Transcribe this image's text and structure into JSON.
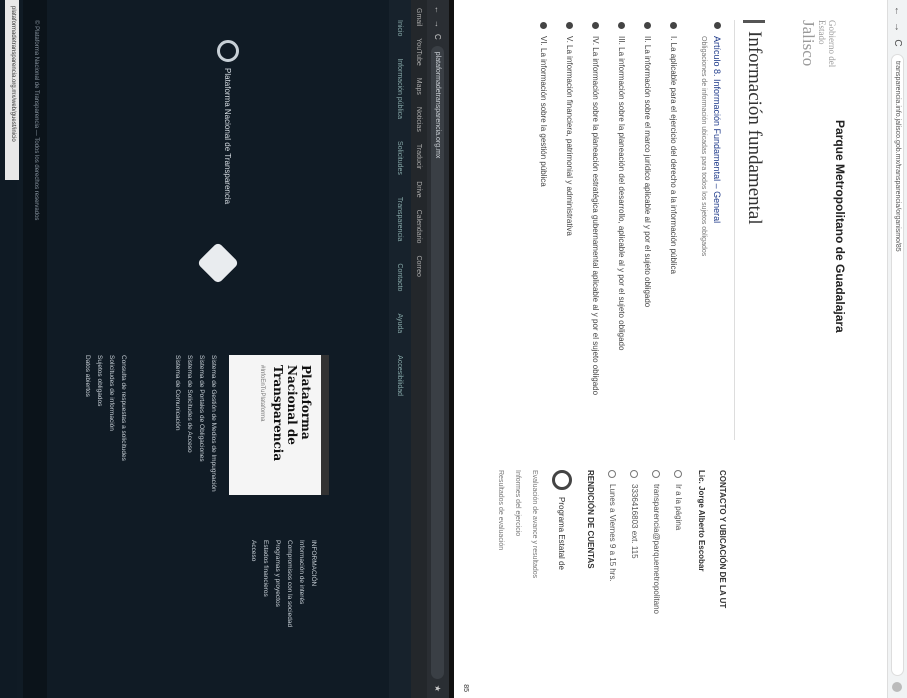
{
  "right_page": {
    "browser": {
      "url": "transparencia.info.jalisco.gob.mx/transparencia/organismo/85",
      "back": "←",
      "forward": "→",
      "reload": "C"
    },
    "logo": {
      "line1": "Gobierno del Estado",
      "line2": "Jalisco"
    },
    "org_title": "Parque Metropolitano de Guadalajara",
    "section_title": "Información fundamental",
    "obligations": [
      {
        "label": "Artículo 8. Información Fundamental – General",
        "sub": "Obligaciones de información ubicadas para todos los sujetos obligados"
      },
      {
        "label": "I. La aplicable para el ejercicio del derecho a la información pública"
      },
      {
        "label": "II. La información sobre el marco jurídico aplicable al y por el sujeto obligado"
      },
      {
        "label": "III. La información sobre la planeación del desarrollo, aplicable al y por el sujeto obligado"
      },
      {
        "label": "IV. La información sobre la planeación estratégica gubernamental aplicable al y por el sujeto obligado"
      },
      {
        "label": "V. La información financiera, patrimonial y administrativa"
      },
      {
        "label": "VI. La información sobre la gestión pública"
      }
    ],
    "contact": {
      "heading": "CONTACTO Y UBICACIÓN DE LA UT",
      "name": "Lic. Jorge Alberto Escobar",
      "rows": [
        "Ir a la página",
        "transparencia@parquemetropolitano",
        "3336416803 ext. 115",
        "Lunes a Viernes 9 a 15 hrs."
      ],
      "heading2": "RENDICIÓN DE CUENTAS",
      "program": "Programa Estatal de",
      "lines": [
        "Evaluación de avance y resultados",
        "Informes del ejercicio",
        "Resultados de evaluación"
      ]
    },
    "page_number": "85"
  },
  "left_page": {
    "browser": {
      "url": "plataformadetransparencia.org.mx"
    },
    "bookmarks": [
      "Gmail",
      "YouTube",
      "Maps",
      "Noticias",
      "Traducir",
      "Drive",
      "Calendario",
      "Correo"
    ],
    "nav": [
      "Inicio",
      "Información pública",
      "Solicitudes",
      "Transparencia",
      "Contacto",
      "Ayuda",
      "Accesibilidad"
    ],
    "brand": "Plataforma Nacional de Transparencia",
    "card_title": "Plataforma Nacional de Transparencia",
    "card_sub": "#InfoEnTuPlataforma",
    "links_1": [
      "Sistema de Gestión de Medios de Impugnación",
      "Sistema de Portales de Obligaciones",
      "Sistema de Solicitudes de Acceso",
      "Sistema de Comunicación"
    ],
    "links_2": [
      "Consulta de respuestas a solicitudes",
      "Solicitudes de información",
      "Sujetos obligados",
      "Datos abiertos"
    ],
    "right_col": [
      "INFORMACIÓN",
      "Información de interés",
      "Compromisos con la sociedad",
      "Programas y proyectos",
      "Estados financieros",
      "Acceso"
    ],
    "footer": "© Plataforma Nacional de Transparencia — Todos los derechos reservados",
    "status": "plataformadetransparencia.org.mx/web/guest/inicio"
  }
}
